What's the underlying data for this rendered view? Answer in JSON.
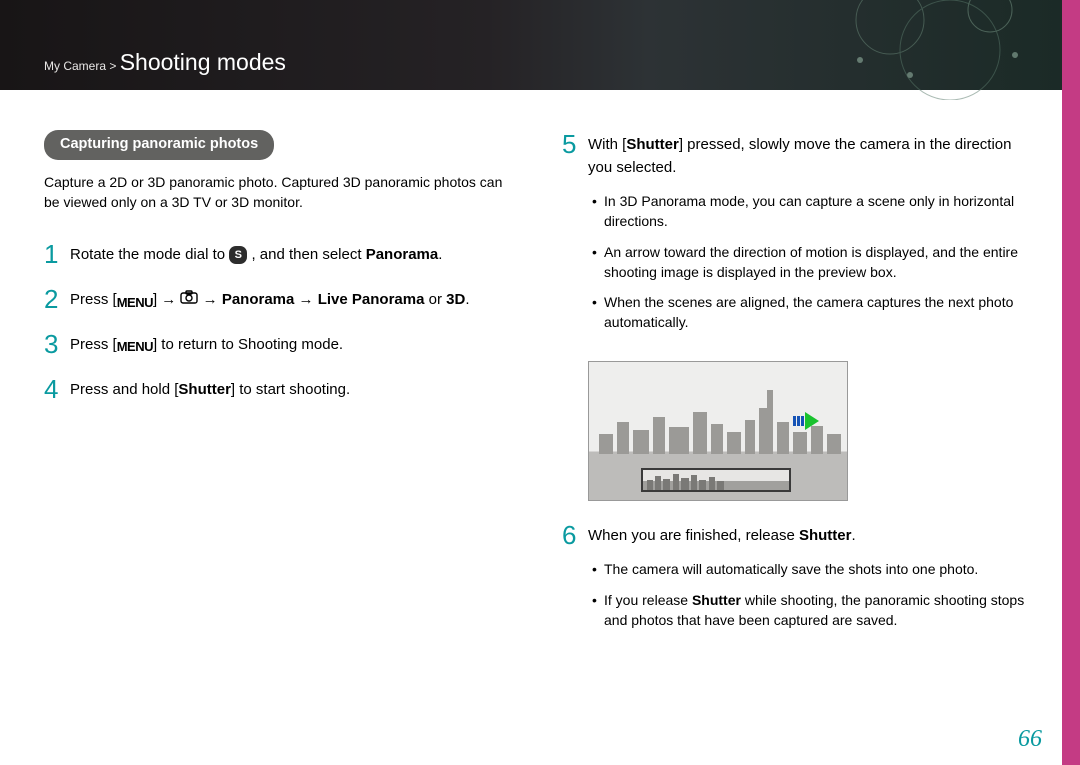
{
  "breadcrumb": {
    "section": "My Camera >",
    "title": "Shooting modes"
  },
  "pill": "Capturing panoramic photos",
  "intro": "Capture a 2D or 3D panoramic photo. Captured 3D panoramic photos can be viewed only on a 3D TV or 3D monitor.",
  "s1": {
    "a": "Rotate the mode dial to ",
    "b": ", and then select ",
    "c": "Panorama",
    "d": "."
  },
  "s2": {
    "a": "Press [",
    "b": "] → ",
    "c": " → ",
    "d": "Panorama",
    "e": " → ",
    "f": "Live Panorama",
    "g": " or ",
    "h": "3D",
    "i": "."
  },
  "s3": {
    "a": "Press [",
    "b": "] to return to Shooting mode."
  },
  "s4": {
    "a": "Press and hold [",
    "b": "Shutter",
    "c": "] to start shooting."
  },
  "s5": {
    "a": "With [",
    "b": "Shutter",
    "c": "] pressed, slowly move the camera in the direction you selected."
  },
  "s5bullets": [
    "In 3D Panorama mode, you can capture a scene only in horizontal directions.",
    "An arrow toward the direction of motion is displayed, and the entire shooting image is displayed in the preview box.",
    "When the scenes are aligned, the camera captures the next photo automatically."
  ],
  "s6": {
    "a": "When you are finished, release ",
    "b": "Shutter",
    "c": "."
  },
  "s6b1": "The camera will automatically save the shots into one photo.",
  "s6b2": {
    "a": "If you release ",
    "b": "Shutter",
    "c": " while shooting, the panoramic shooting stops and photos that have been captured are saved."
  },
  "icons": {
    "menu_label": "MENU",
    "s_label": "S"
  },
  "pagenum": "66"
}
